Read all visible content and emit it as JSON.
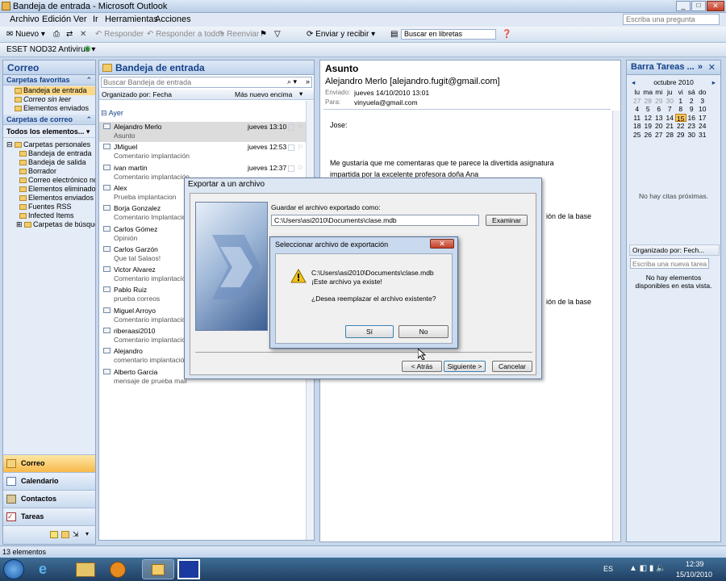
{
  "window": {
    "title": "Bandeja de entrada - Microsoft Outlook"
  },
  "menu": {
    "items": [
      "Archivo",
      "Edición",
      "Ver",
      "Ir",
      "Herramientas",
      "Acciones"
    ],
    "ask_placeholder": "Escriba una pregunta"
  },
  "toolbar": {
    "new": "Nuevo",
    "reply": "Responder",
    "reply_all": "Responder a todos",
    "forward": "Reenviar",
    "send_receive": "Enviar y recibir",
    "search_books": "Buscar en libretas",
    "antivirus": "ESET NOD32 Antivirus"
  },
  "nav": {
    "title": "Correo",
    "favorites_header": "Carpetas favoritas",
    "favorites": [
      "Bandeja de entrada",
      "Correo sin leer",
      "Elementos enviados"
    ],
    "mail_folders_header": "Carpetas de correo",
    "all_items": "Todos los elementos...",
    "tree_root": "Carpetas personales",
    "tree": [
      "Bandeja de entrada",
      "Bandeja de salida",
      "Borrador",
      "Correo electrónico no",
      "Elementos eliminados",
      "Elementos enviados",
      "Fuentes RSS",
      "Infected Items",
      "Carpetas de búsqueda"
    ],
    "bottom": [
      "Correo",
      "Calendario",
      "Contactos",
      "Tareas"
    ]
  },
  "maillist": {
    "title": "Bandeja de entrada",
    "search_placeholder": "Buscar Bandeja de entrada",
    "arranged": "Organizado por: Fecha",
    "order": "Más nuevo encima",
    "group": "Ayer",
    "items": [
      {
        "from": "Alejandro Merlo",
        "subject": "Asunto",
        "date": "jueves 13:10"
      },
      {
        "from": "JMiguel",
        "subject": "Comentario implantación",
        "date": "jueves 12:53"
      },
      {
        "from": "ivan martin",
        "subject": "Comentario implantación",
        "date": "jueves 12:37"
      },
      {
        "from": "Alex",
        "subject": "Prueba implantacion",
        "date": ""
      },
      {
        "from": "Borja Gonzalez",
        "subject": "Comentario Implantación",
        "date": ""
      },
      {
        "from": "Carlos Gómez",
        "subject": "Opinión",
        "date": ""
      },
      {
        "from": "Carlos Garzón",
        "subject": "Que tal Salaos!",
        "date": ""
      },
      {
        "from": "Victor Alvarez",
        "subject": "Comentario implantación",
        "date": ""
      },
      {
        "from": "Pablo Ruiz",
        "subject": "prueba correos",
        "date": ""
      },
      {
        "from": "Miguel Arroyo",
        "subject": "Comentario implantación",
        "date": ""
      },
      {
        "from": "riberaasi2010",
        "subject": "Comentario implantación",
        "date": ""
      },
      {
        "from": "Alejandro",
        "subject": "comentario implantación",
        "date": ""
      },
      {
        "from": "Alberto Garcia",
        "subject": "mensaje de prueba mail",
        "date": ""
      }
    ]
  },
  "reading": {
    "subject": "Asunto",
    "from": "Alejandro Merlo  [alejandro.fugit@gmail.com]",
    "sent_label": "Enviado:",
    "sent_value": "jueves 14/10/2010 13:01",
    "to_label": "Para:",
    "to_value": "vinyuela@gmail.com",
    "greeting": "Jose:",
    "body1": "Me gustaría que me  comentaras que te parece la divertida asignatura",
    "body2": "impartida por la excelente profesora doña Ana",
    "frag1": "ión de la base",
    "frag2": "ión de la base"
  },
  "todo": {
    "title": "Barra Tareas ...",
    "month": "octubre 2010",
    "weekdays": [
      "lu",
      "ma",
      "mi",
      "ju",
      "vi",
      "sá",
      "do"
    ],
    "weeks": [
      [
        "27",
        "28",
        "29",
        "30",
        "1",
        "2",
        "3"
      ],
      [
        "4",
        "5",
        "6",
        "7",
        "8",
        "9",
        "10"
      ],
      [
        "11",
        "12",
        "13",
        "14",
        "15",
        "16",
        "17"
      ],
      [
        "18",
        "19",
        "20",
        "21",
        "22",
        "23",
        "24"
      ],
      [
        "25",
        "26",
        "27",
        "28",
        "29",
        "30",
        "31"
      ]
    ],
    "no_appointments": "No hay citas próximas.",
    "arranged": "Organizado por: Fech...",
    "new_task_placeholder": "Escriba una nueva tarea",
    "no_tasks": "No hay elementos disponibles en esta vista."
  },
  "export_dialog": {
    "title": "Exportar a un archivo",
    "save_label": "Guardar el archivo exportado como:",
    "path": "C:\\Users\\asi2010\\Documents\\clase.mdb",
    "browse": "Examinar",
    "back": "< Atrás",
    "next": "Siguiente >",
    "cancel": "Cancelar"
  },
  "confirm_dialog": {
    "title": "Seleccionar archivo de exportación",
    "line1": "C:\\Users\\asi2010\\Documents\\clase.mdb",
    "line2": "¡Este archivo ya existe!",
    "question": "¿Desea reemplazar el archivo existente?",
    "yes": "Sí",
    "no": "No"
  },
  "status": {
    "items": "13 elementos"
  },
  "taskbar": {
    "lang": "ES",
    "time": "12:39",
    "date": "15/10/2010"
  }
}
